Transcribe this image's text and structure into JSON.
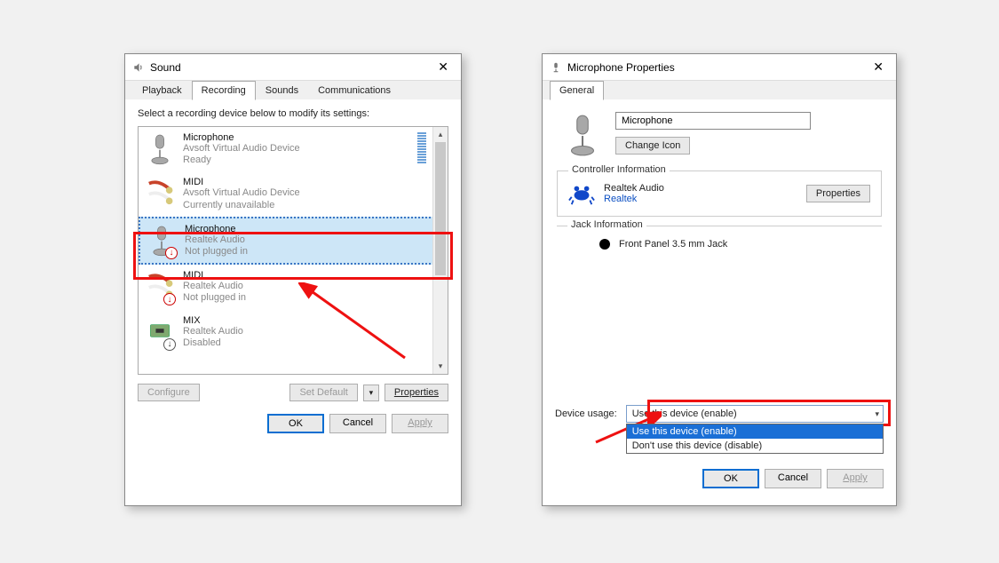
{
  "sound_dialog": {
    "title": "Sound",
    "tabs": [
      "Playback",
      "Recording",
      "Sounds",
      "Communications"
    ],
    "active_tab": 1,
    "instruction": "Select a recording device below to modify its settings:",
    "devices": [
      {
        "name": "Microphone",
        "subtitle": "Avsoft Virtual Audio Device",
        "status": "Ready",
        "icon": "mic",
        "selected": false,
        "showLevel": true
      },
      {
        "name": "MIDI",
        "subtitle": "Avsoft Virtual Audio Device",
        "status": "Currently unavailable",
        "icon": "cable",
        "selected": false
      },
      {
        "name": "Microphone",
        "subtitle": "Realtek Audio",
        "status": "Not plugged in",
        "icon": "mic-down",
        "selected": true
      },
      {
        "name": "MIDI",
        "subtitle": "Realtek Audio",
        "status": "Not plugged in",
        "icon": "cable-down",
        "selected": false
      },
      {
        "name": "MIX",
        "subtitle": "Realtek Audio",
        "status": "Disabled",
        "icon": "chip-down",
        "selected": false
      }
    ],
    "configure_label": "Configure",
    "set_default_label": "Set Default",
    "properties_label": "Properties",
    "ok_label": "OK",
    "cancel_label": "Cancel",
    "apply_label": "Apply"
  },
  "mic_props_dialog": {
    "title": "Microphone Properties",
    "tabs": [
      "General"
    ],
    "active_tab": 0,
    "device_name_value": "Microphone",
    "change_icon_label": "Change Icon",
    "controller_section_label": "Controller Information",
    "controller_name": "Realtek Audio",
    "controller_vendor": "Realtek",
    "controller_properties_label": "Properties",
    "jack_section_label": "Jack Information",
    "jack_text": "Front Panel 3.5 mm Jack",
    "usage_label": "Device usage:",
    "usage_selected": "Use this device (enable)",
    "usage_options": [
      "Use this device (enable)",
      "Don't use this device (disable)"
    ],
    "ok_label": "OK",
    "cancel_label": "Cancel",
    "apply_label": "Apply"
  }
}
